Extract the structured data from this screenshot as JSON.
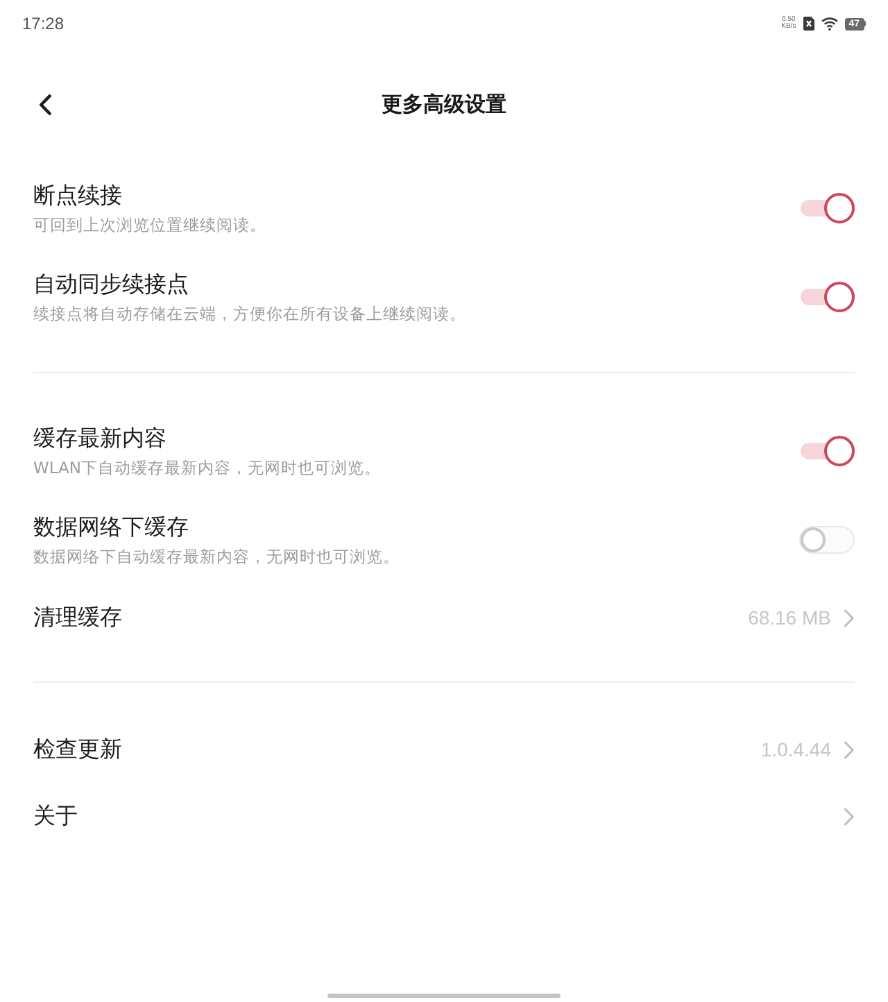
{
  "status_bar": {
    "time": "17:28",
    "net_speed": "0.50",
    "net_speed_unit": "KB/s",
    "battery": "47"
  },
  "header": {
    "title": "更多高级设置"
  },
  "sections": [
    {
      "items": [
        {
          "kind": "toggle",
          "title": "断点续接",
          "subtitle": "可回到上次浏览位置继续阅读。",
          "on": true
        },
        {
          "kind": "toggle",
          "title": "自动同步续接点",
          "subtitle": "续接点将自动存储在云端，方便你在所有设备上继续阅读。",
          "on": true
        }
      ]
    },
    {
      "items": [
        {
          "kind": "toggle",
          "title": "缓存最新内容",
          "subtitle": "WLAN下自动缓存最新内容，无网时也可浏览。",
          "on": true
        },
        {
          "kind": "toggle",
          "title": "数据网络下缓存",
          "subtitle": "数据网络下自动缓存最新内容，无网时也可浏览。",
          "on": false
        },
        {
          "kind": "link",
          "title": "清理缓存",
          "value": "68.16 MB"
        }
      ]
    },
    {
      "items": [
        {
          "kind": "link",
          "title": "检查更新",
          "value": "1.0.4.44"
        },
        {
          "kind": "link",
          "title": "关于"
        }
      ]
    }
  ]
}
